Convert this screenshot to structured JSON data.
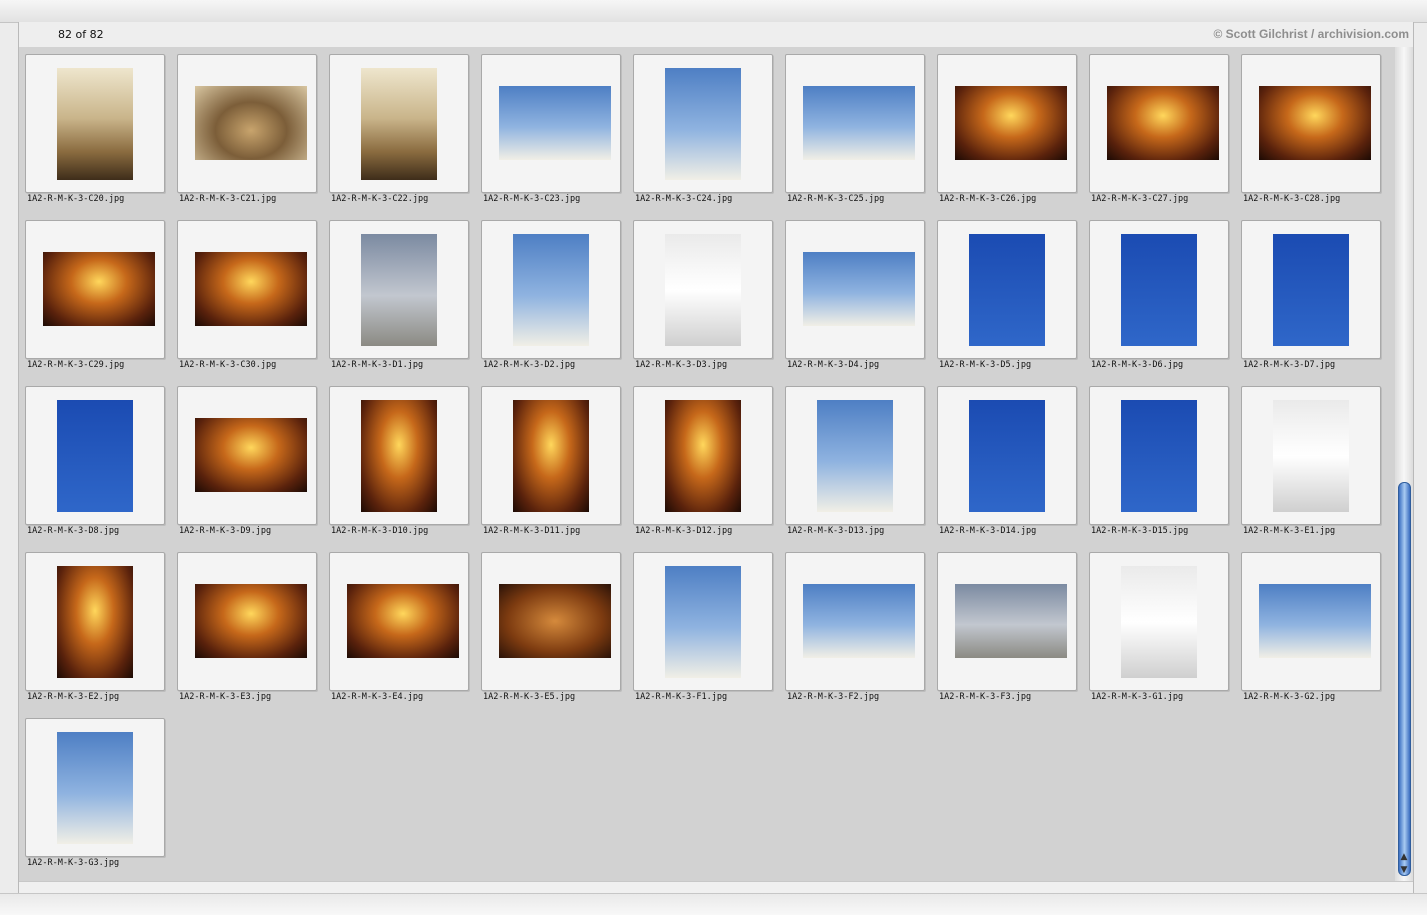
{
  "header": {
    "count": "82 of 82",
    "copyright": "© Scott Gilchrist / archivision.com"
  },
  "icons": {
    "scroll_up": "scroll-up-arrow-icon",
    "scroll_down": "scroll-down-arrow-icon"
  },
  "colors": {
    "scrollbar_thumb": "#3b6fc2",
    "window_background": "#d2d2d2"
  },
  "images": [
    {
      "name": "1A2-R-M-K-3-C20.jpg",
      "orientation": "portrait",
      "tone": "ext"
    },
    {
      "name": "1A2-R-M-K-3-C21.jpg",
      "orientation": "landscape",
      "tone": "fresco"
    },
    {
      "name": "1A2-R-M-K-3-C22.jpg",
      "orientation": "portrait",
      "tone": "ext"
    },
    {
      "name": "1A2-R-M-K-3-C23.jpg",
      "orientation": "landscape",
      "tone": "sky"
    },
    {
      "name": "1A2-R-M-K-3-C24.jpg",
      "orientation": "portrait",
      "tone": "sky"
    },
    {
      "name": "1A2-R-M-K-3-C25.jpg",
      "orientation": "landscape",
      "tone": "sky"
    },
    {
      "name": "1A2-R-M-K-3-C26.jpg",
      "orientation": "landscape",
      "tone": "gold"
    },
    {
      "name": "1A2-R-M-K-3-C27.jpg",
      "orientation": "landscape",
      "tone": "gold"
    },
    {
      "name": "1A2-R-M-K-3-C28.jpg",
      "orientation": "landscape",
      "tone": "gold"
    },
    {
      "name": "1A2-R-M-K-3-C29.jpg",
      "orientation": "landscape",
      "tone": "gold"
    },
    {
      "name": "1A2-R-M-K-3-C30.jpg",
      "orientation": "landscape",
      "tone": "gold"
    },
    {
      "name": "1A2-R-M-K-3-D1.jpg",
      "orientation": "portrait",
      "tone": "cloud"
    },
    {
      "name": "1A2-R-M-K-3-D2.jpg",
      "orientation": "portrait",
      "tone": "sky"
    },
    {
      "name": "1A2-R-M-K-3-D3.jpg",
      "orientation": "portrait",
      "tone": "white"
    },
    {
      "name": "1A2-R-M-K-3-D4.jpg",
      "orientation": "landscape",
      "tone": "sky"
    },
    {
      "name": "1A2-R-M-K-3-D5.jpg",
      "orientation": "portrait",
      "tone": "blue"
    },
    {
      "name": "1A2-R-M-K-3-D6.jpg",
      "orientation": "portrait",
      "tone": "blue"
    },
    {
      "name": "1A2-R-M-K-3-D7.jpg",
      "orientation": "portrait",
      "tone": "blue"
    },
    {
      "name": "1A2-R-M-K-3-D8.jpg",
      "orientation": "portrait",
      "tone": "blue"
    },
    {
      "name": "1A2-R-M-K-3-D9.jpg",
      "orientation": "landscape",
      "tone": "gold"
    },
    {
      "name": "1A2-R-M-K-3-D10.jpg",
      "orientation": "portrait",
      "tone": "gold"
    },
    {
      "name": "1A2-R-M-K-3-D11.jpg",
      "orientation": "portrait",
      "tone": "gold"
    },
    {
      "name": "1A2-R-M-K-3-D12.jpg",
      "orientation": "portrait",
      "tone": "gold"
    },
    {
      "name": "1A2-R-M-K-3-D13.jpg",
      "orientation": "portrait",
      "tone": "sky"
    },
    {
      "name": "1A2-R-M-K-3-D14.jpg",
      "orientation": "portrait",
      "tone": "blue"
    },
    {
      "name": "1A2-R-M-K-3-D15.jpg",
      "orientation": "portrait",
      "tone": "blue"
    },
    {
      "name": "1A2-R-M-K-3-E1.jpg",
      "orientation": "portrait",
      "tone": "white"
    },
    {
      "name": "1A2-R-M-K-3-E2.jpg",
      "orientation": "portrait",
      "tone": "gold"
    },
    {
      "name": "1A2-R-M-K-3-E3.jpg",
      "orientation": "landscape",
      "tone": "gold"
    },
    {
      "name": "1A2-R-M-K-3-E4.jpg",
      "orientation": "landscape",
      "tone": "gold"
    },
    {
      "name": "1A2-R-M-K-3-E5.jpg",
      "orientation": "landscape",
      "tone": "carv"
    },
    {
      "name": "1A2-R-M-K-3-F1.jpg",
      "orientation": "portrait",
      "tone": "sky"
    },
    {
      "name": "1A2-R-M-K-3-F2.jpg",
      "orientation": "landscape",
      "tone": "sky"
    },
    {
      "name": "1A2-R-M-K-3-F3.jpg",
      "orientation": "landscape",
      "tone": "cloud"
    },
    {
      "name": "1A2-R-M-K-3-G1.jpg",
      "orientation": "portrait",
      "tone": "white"
    },
    {
      "name": "1A2-R-M-K-3-G2.jpg",
      "orientation": "landscape",
      "tone": "sky"
    },
    {
      "name": "1A2-R-M-K-3-G3.jpg",
      "orientation": "portrait",
      "tone": "sky"
    }
  ]
}
